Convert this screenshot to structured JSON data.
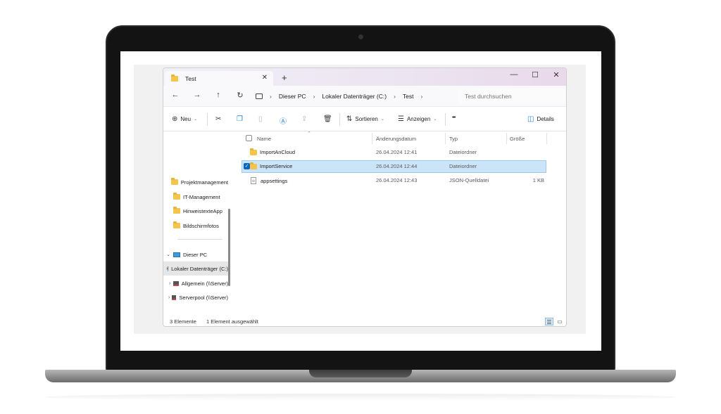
{
  "window": {
    "tab_title": "Test",
    "tab_close": "✕",
    "tab_add": "+",
    "minimize": "—",
    "maximize": "☐",
    "close": "✕"
  },
  "navbar": {
    "back": "←",
    "forward": "→",
    "up": "↑",
    "refresh": "↻",
    "breadcrumbs": [
      "Dieser PC",
      "Lokaler Datenträger (C:)",
      "Test"
    ],
    "search_placeholder": "Test durchsuchen"
  },
  "toolbar": {
    "new_label": "Neu",
    "sort_label": "Sortieren",
    "view_label": "Anzeigen",
    "more_label": "•••",
    "details_label": "Details"
  },
  "sidebar": {
    "items": [
      {
        "label": "Projektmanagement",
        "type": "folder"
      },
      {
        "label": "IT-Management",
        "type": "folder"
      },
      {
        "label": "HinweistexteApp",
        "type": "folder"
      },
      {
        "label": "Bildschirmfotos",
        "type": "folder"
      },
      {
        "label": "Dieser PC",
        "type": "pc",
        "chevron": "⌄"
      },
      {
        "label": "Lokaler Datenträger (C:)",
        "type": "drive",
        "chevron": "›"
      },
      {
        "label": "Allgemein (\\\\Server)",
        "type": "net",
        "chevron": "›"
      },
      {
        "label": "Serverpool (\\\\Server)",
        "type": "net",
        "chevron": "›"
      }
    ]
  },
  "columns": {
    "name": "Name",
    "modified": "Änderungsdatum",
    "type": "Typ",
    "size": "Größe"
  },
  "files": [
    {
      "name": "ImportAnCloud",
      "modified": "26.04.2024 12:41",
      "type": "Dateiordner",
      "size": "",
      "kind": "folder"
    },
    {
      "name": "ImportService",
      "modified": "26.04.2024 12:44",
      "type": "Dateiordner",
      "size": "",
      "kind": "folder",
      "selected": true
    },
    {
      "name": "appsettings",
      "modified": "26.04.2024 12:43",
      "type": "JSON-Quelldatei",
      "size": "1 KB",
      "kind": "file"
    }
  ],
  "status": {
    "count": "3 Elemente",
    "selection": "1 Element ausgewählt"
  },
  "colors": {
    "selection_bg": "#cce4f7",
    "selection_border": "#9ccbef",
    "folder": "#f3c54d",
    "checkbox_on": "#0a64c4"
  }
}
